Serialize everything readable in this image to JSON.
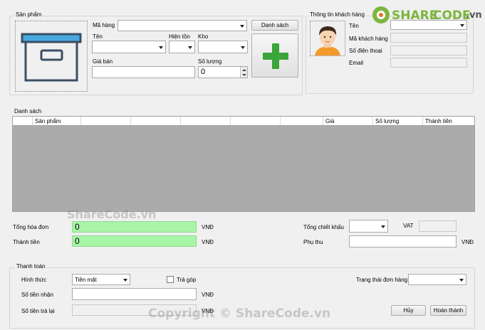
{
  "product_group": {
    "title": "Sản phẩm",
    "code_label": "Mã hàng",
    "list_button": "Danh sách",
    "name_label": "Tên",
    "stock_label": "Hiện tồn",
    "warehouse_label": "Kho",
    "price_label": "Giá bán",
    "quantity_label": "Số lượng",
    "quantity_value": "0",
    "add_icon": "plus-icon",
    "image_icon": "archive-box-icon"
  },
  "customer_group": {
    "title": "Thông tin khách hàng",
    "name_label": "Tên",
    "code_label": "Mã khách hàng",
    "phone_label": "Số điện thoại",
    "email_label": "Email",
    "avatar_icon": "user-avatar-icon"
  },
  "list_group": {
    "title": "Danh sách",
    "columns": [
      "",
      "Sản phẩm",
      "",
      "",
      "",
      "",
      "",
      "Giá",
      "Số lượng",
      "Thành tiền"
    ]
  },
  "totals": {
    "invoice_total_label": "Tổng hóa đơn",
    "invoice_total_value": "0",
    "invoice_total_unit": "VNĐ",
    "amount_label": "Thành tiền",
    "amount_value": "0",
    "amount_unit": "VNĐ",
    "discount_label": "Tổng chiết khấu",
    "vat_label": "VAT",
    "surcharge_label": "Phụ thu",
    "surcharge_unit": "VNĐ"
  },
  "payment": {
    "title": "Thanh toán",
    "method_label": "Hình thức",
    "method_value": "Tiền mặt",
    "installment_label": "Trả góp",
    "order_status_label": "Trạng thái đơn hàng",
    "received_label": "Số tiền nhận",
    "received_unit": "VNĐ",
    "change_label": "Số tiền trả lại",
    "change_unit": "VNĐ",
    "cancel_button": "Hủy",
    "complete_button": "Hoàn thành"
  },
  "branding": {
    "logo_text_share": "SHARE",
    "logo_text_code": "CODE",
    "logo_text_domain": ".vn",
    "watermark_center": "ShareCode.vn",
    "watermark_bottom": "Copyright © ShareCode.vn",
    "colors": {
      "logo_green": "#7cb63f",
      "plus_green": "#3aa53a",
      "accent_field": "#a8f5a8"
    }
  }
}
